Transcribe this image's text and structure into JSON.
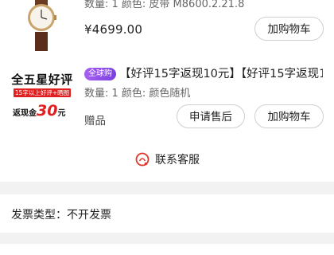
{
  "item1": {
    "meta": "数量: 1 颜色: 皮带 M8600.2.21.8",
    "price": "¥4699.00",
    "cart_button": "加购物车",
    "thumbnail_icon": "watch-icon"
  },
  "item2": {
    "promo": {
      "line1": "全五星好评",
      "line2": "15字以上好评+晒图",
      "line3_prefix": "返现金",
      "line3_amount": "30",
      "line3_suffix": "元"
    },
    "tag": "全球购",
    "title": "【好评15字返现10元】【好评15字返现10元】",
    "meta": "数量: 1 颜色: 颜色随机",
    "gift": "赠品",
    "after_sale_button": "申请售后",
    "cart_button": "加购物车"
  },
  "service": {
    "label": "联系客服",
    "icon": "customer-service-icon",
    "icon_color": "#e03a2e"
  },
  "invoice": {
    "text": "发票类型：不开发票"
  }
}
